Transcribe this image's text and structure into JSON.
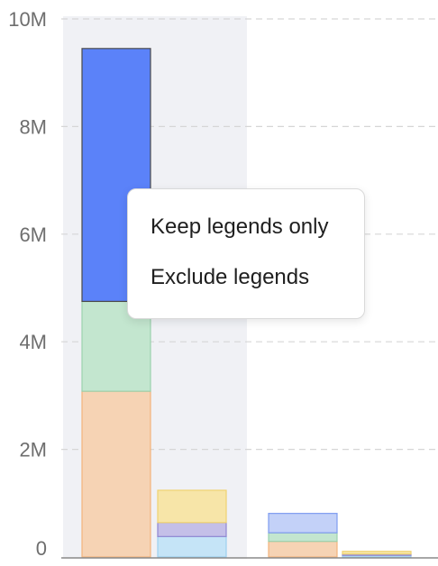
{
  "chart_data": {
    "type": "bar",
    "stacked": true,
    "grouped": true,
    "ylim": [
      0,
      10000000
    ],
    "y_ticks": [
      0,
      2000000,
      4000000,
      6000000,
      8000000,
      10000000
    ],
    "y_tick_labels": [
      "0",
      "2M",
      "4M",
      "6M",
      "8M",
      "10M"
    ],
    "grid": "horizontal-dashed",
    "highlighted_category_index": 0,
    "categories": [
      "",
      ""
    ],
    "groups": [
      {
        "category_index": 0,
        "bars": [
          {
            "segments": [
              {
                "value": 3080000,
                "color": "#f6d3b4",
                "stroke": "#f2b37c"
              },
              {
                "value": 1670000,
                "color": "#c3e6cf",
                "stroke": "#9bd1ae"
              },
              {
                "value": 4700000,
                "color": "#5b82f9",
                "stroke": "#4a4a4a"
              }
            ]
          },
          {
            "segments": [
              {
                "value": 380000,
                "color": "#c5e4f7",
                "stroke": "#9dd0f0"
              },
              {
                "value": 260000,
                "color": "#c4bfe8",
                "stroke": "#8f87d1"
              },
              {
                "value": 600000,
                "color": "#f7e5a8",
                "stroke": "#f0d370"
              }
            ]
          }
        ]
      },
      {
        "category_index": 1,
        "bars": [
          {
            "segments": [
              {
                "value": 290000,
                "color": "#f6d3b4",
                "stroke": "#f2b37c"
              },
              {
                "value": 160000,
                "color": "#c3e6cf",
                "stroke": "#9bd1ae"
              },
              {
                "value": 360000,
                "color": "#c3d1f8",
                "stroke": "#7f9cf0"
              }
            ]
          },
          {
            "segments": [
              {
                "value": 30000,
                "color": "#c5e4f7",
                "stroke": "#9dd0f0"
              },
              {
                "value": 25000,
                "color": "#c4bfe8",
                "stroke": "#8f87d1"
              },
              {
                "value": 50000,
                "color": "#f7e5a8",
                "stroke": "#f0d370"
              }
            ]
          }
        ]
      }
    ]
  },
  "context_menu": {
    "items": [
      {
        "label": "Keep legends only"
      },
      {
        "label": "Exclude legends"
      }
    ]
  }
}
